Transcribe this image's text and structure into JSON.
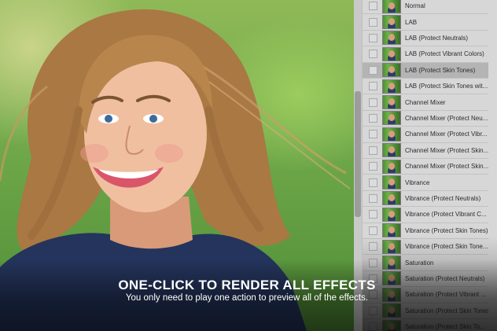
{
  "caption": {
    "headline": "ONE-CLICK TO RENDER ALL EFFECTS",
    "subline": "You only need to play one action to preview all of the effects."
  },
  "layers_panel": {
    "selected_index": 4,
    "items": [
      {
        "label": "Normal"
      },
      {
        "label": "LAB"
      },
      {
        "label": "LAB (Protect Neutrals)"
      },
      {
        "label": "LAB (Protect Vibrant Colors)"
      },
      {
        "label": "LAB (Protect Skin Tones)"
      },
      {
        "label": "LAB (Protect Skin Tones wit..."
      },
      {
        "label": "Channel Mixer"
      },
      {
        "label": "Channel Mixer (Protect Neu..."
      },
      {
        "label": "Channel Mixer (Protect Vibr..."
      },
      {
        "label": "Channel Mixer (Protect Skin..."
      },
      {
        "label": "Channel Mixer (Protect Skin..."
      },
      {
        "label": "Vibrance"
      },
      {
        "label": "Vibrance (Protect Neutrals)"
      },
      {
        "label": "Vibrance (Protect Vibrant C..."
      },
      {
        "label": "Vibrance (Protect Skin Tones)"
      },
      {
        "label": "Vibrance (Protect Skin Tone..."
      },
      {
        "label": "Saturation"
      },
      {
        "label": "Saturation (Protect  Neutrals)"
      },
      {
        "label": "Saturation (Protect Vibrant ..."
      },
      {
        "label": "Saturation (Protect Skin Tones)"
      },
      {
        "label": "Saturation (Protect Skin To..."
      }
    ]
  }
}
